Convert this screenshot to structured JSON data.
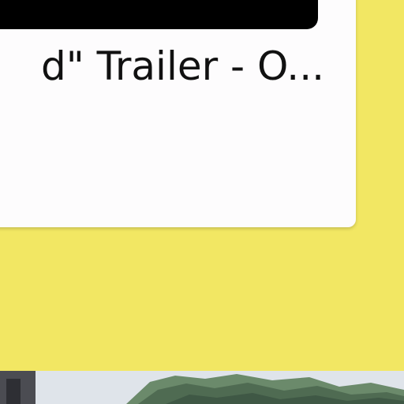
{
  "video_card": {
    "title_visible": "d\" Trailer - O..."
  },
  "colors": {
    "page_background": "#f2e763",
    "card_background": "#fdfcfd",
    "thumbnail": "#000000",
    "title_text": "#111111"
  }
}
